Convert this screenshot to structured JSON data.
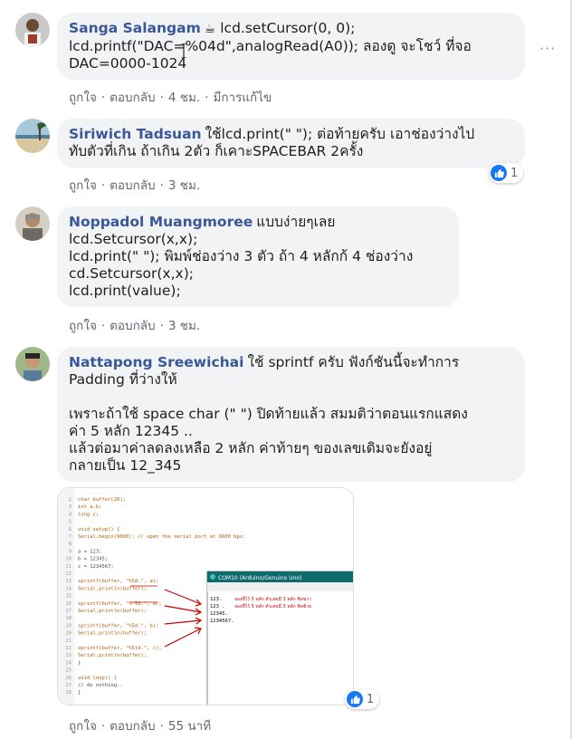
{
  "comments": [
    {
      "author": "Sanga Salangam",
      "lines": [
        "lcd.setCursor(0, 0);",
        "lcd.printf(\"DAC=%04d\",analogRead(A0)); ลองดู จะโชว์ ที่จอ",
        "DAC=0000-1024"
      ],
      "emoji": "coffee-emoji",
      "actions": {
        "like": "ถูกใจ",
        "reply": "ตอบกลับ",
        "time": "4 ชม.",
        "edited": "มีการแก้ไข"
      }
    },
    {
      "author": "Siriwich Tadsuan",
      "lines": [
        "ใช้lcd.print(\" \"); ต่อท้ายครับ เอาช่องว่างไป",
        "ทับตัวที่เกิน ถ้าเกิน 2ตัว ก็เคาะSPACEBAR 2ครั้ง"
      ],
      "reaction_count": "1",
      "actions": {
        "like": "ถูกใจ",
        "reply": "ตอบกลับ",
        "time": "3 ชม."
      }
    },
    {
      "author": "Noppadol Muangmoree",
      "lines": [
        "แบบง่ายๆเลย",
        "lcd.Setcursor(x,x);",
        "lcd.print(\" \"); พิมพ์ช่องว่าง 3 ตัว ถ้า 4 หลักก้ 4 ช่องว่าง",
        "cd.Setcursor(x,x);",
        "lcd.print(value);"
      ],
      "actions": {
        "like": "ถูกใจ",
        "reply": "ตอบกลับ",
        "time": "3 ชม."
      }
    },
    {
      "author": "Nattapong Sreewichai",
      "lines": [
        "ใช้ sprintf ครับ ฟังก์ชันนี้จะทำการ",
        "Padding ที่ว่างให้",
        "",
        "เพราะถ้าใช้ space char (\" \") ปิดท้ายแล้ว สมมติว่าตอนแรกแสดง",
        "ค่า 5 หลัก 12345 ..",
        "แล้วต่อมาค่าลดลงเหลือ 2 หลัก ค่าท้ายๆ ของเลขเดิมจะยังอยู่",
        "กลายเป็น 12_345"
      ],
      "reaction_count": "1",
      "actions": {
        "like": "ถูกใจ",
        "reply": "ตอบกลับ",
        "time": "55 นาที"
      }
    }
  ],
  "more_menu": "···",
  "attachment": {
    "code": [
      {
        "n": "2",
        "t": "char buffer[20];"
      },
      {
        "n": "3",
        "t": "int a,b;"
      },
      {
        "n": "4",
        "t": "long c;"
      },
      {
        "n": "5",
        "t": ""
      },
      {
        "n": "6",
        "t": "void setup() {"
      },
      {
        "n": "7",
        "t": "  Serial.begin(9600);      // open the serial port at 9600 bps:"
      },
      {
        "n": "8",
        "t": ""
      },
      {
        "n": "9",
        "t": "  a = 123;"
      },
      {
        "n": "10",
        "t": "  b = 12345;"
      },
      {
        "n": "11",
        "t": "  c = 1234567;"
      },
      {
        "n": "12",
        "t": ""
      },
      {
        "n": "13",
        "t": "  sprintf(buffer, \"%5d.\", a);"
      },
      {
        "n": "14",
        "t": "  Serial.println(buffer);"
      },
      {
        "n": "15",
        "t": ""
      },
      {
        "n": "16",
        "t": "  sprintf(buffer, \"%-5d.\", a);"
      },
      {
        "n": "17",
        "t": "  Serial.println(buffer);"
      },
      {
        "n": "18",
        "t": ""
      },
      {
        "n": "19",
        "t": "  sprintf(buffer, \"%5d.\", b);"
      },
      {
        "n": "20",
        "t": "  Serial.println(buffer);"
      },
      {
        "n": "21",
        "t": ""
      },
      {
        "n": "22",
        "t": "  sprintf(buffer, \"%5ld.\", c);"
      },
      {
        "n": "23",
        "t": "  Serial.println(buffer);"
      },
      {
        "n": "24",
        "t": "}"
      },
      {
        "n": "25",
        "t": ""
      },
      {
        "n": "26",
        "t": "void loop() {"
      },
      {
        "n": "27",
        "t": "  // do nothing.."
      },
      {
        "n": "28",
        "t": "}"
      }
    ],
    "serial_title": "COM10 (Arduino/Genuino Uno)",
    "serial_lines": [
      {
        "t": "  123.",
        "note": "จองที่ไว้ 5 หลัก ตัวเลขมี 3 หลัก ชิดขวา"
      },
      {
        "t": "123  .",
        "note": "จองที่ไว้ 5 หลัก ตัวเลขมี 3 หลัก ชิดซ้าย"
      },
      {
        "t": "12345.",
        "note": ""
      },
      {
        "t": "1234567.",
        "note": ""
      }
    ]
  },
  "colors": {
    "name": "#385898",
    "bubble": "#f2f3f5",
    "meta": "#606770",
    "like": "#1877f2",
    "annotation": "#cc0000"
  }
}
